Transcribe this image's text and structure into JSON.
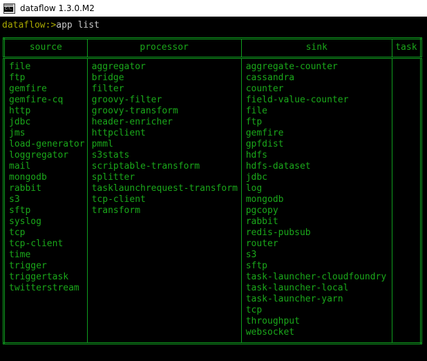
{
  "window": {
    "title": "dataflow 1.3.0.M2",
    "icon": "console-icon",
    "icon_glyph": "C:\\."
  },
  "console": {
    "prompt_prefix": "dataflow:>",
    "command": "app list",
    "background_color": "#000000",
    "prompt_color": "#a8a800",
    "command_color": "#c8c8c8",
    "table_border_color": "#0f9f1f",
    "table_text_color": "#1aa81a"
  },
  "table": {
    "headers": [
      "source",
      "processor",
      "sink",
      "task"
    ],
    "columns": {
      "source": [
        "file",
        "ftp",
        "gemfire",
        "gemfire-cq",
        "http",
        "jdbc",
        "jms",
        "load-generator",
        "loggregator",
        "mail",
        "mongodb",
        "rabbit",
        "s3",
        "sftp",
        "syslog",
        "tcp",
        "tcp-client",
        "time",
        "trigger",
        "triggertask",
        "twitterstream"
      ],
      "processor": [
        "aggregator",
        "bridge",
        "filter",
        "groovy-filter",
        "groovy-transform",
        "header-enricher",
        "httpclient",
        "pmml",
        "s3stats",
        "scriptable-transform",
        "splitter",
        "tasklaunchrequest-transform",
        "tcp-client",
        "transform"
      ],
      "sink": [
        "aggregate-counter",
        "cassandra",
        "counter",
        "field-value-counter",
        "file",
        "ftp",
        "gemfire",
        "gpfdist",
        "hdfs",
        "hdfs-dataset",
        "jdbc",
        "log",
        "mongodb",
        "pgcopy",
        "rabbit",
        "redis-pubsub",
        "router",
        "s3",
        "sftp",
        "task-launcher-cloudfoundry",
        "task-launcher-local",
        "task-launcher-yarn",
        "tcp",
        "throughput",
        "websocket"
      ],
      "task": []
    }
  }
}
